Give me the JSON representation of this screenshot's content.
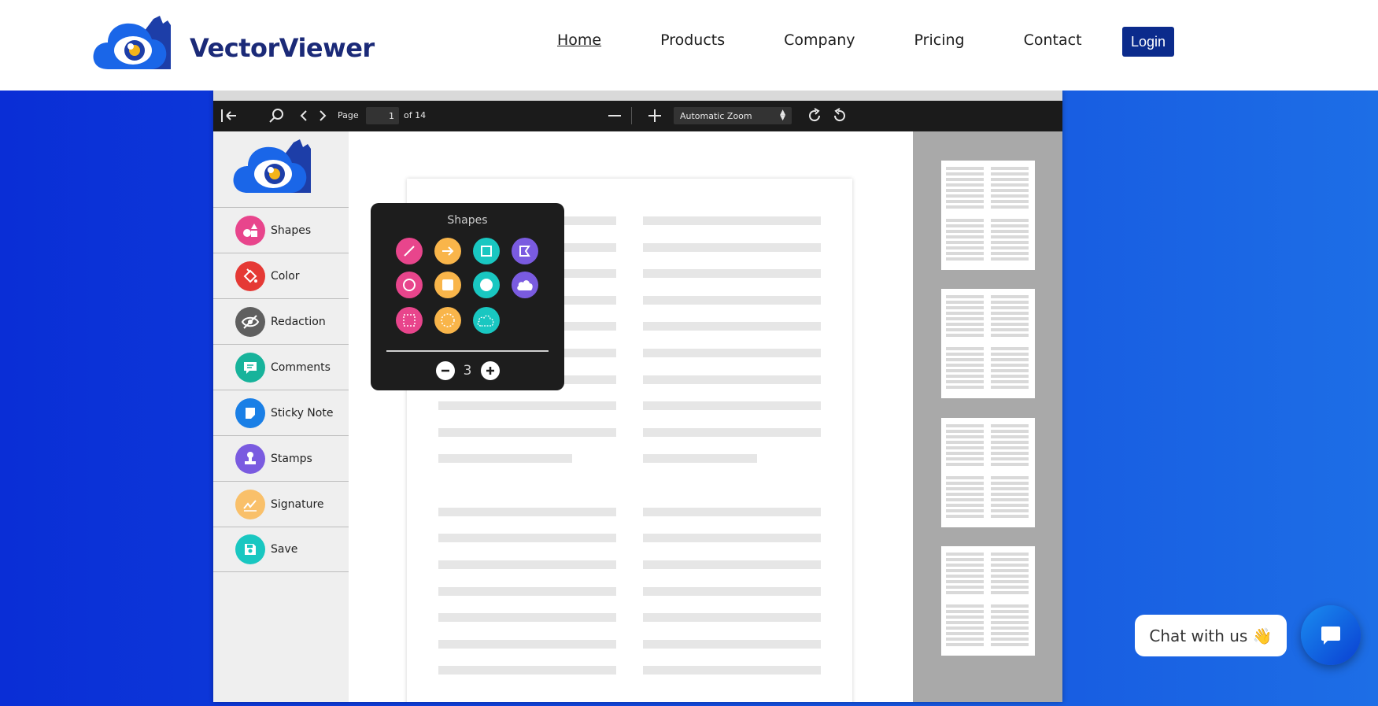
{
  "nav": {
    "brand": "VectorViewer",
    "links": [
      "Home",
      "Products",
      "Company",
      "Pricing",
      "Contact"
    ],
    "login": "Login"
  },
  "viewer": {
    "toolbar": {
      "page_label": "Page",
      "page_value": "1",
      "page_total": "of 14",
      "zoom": "Automatic Zoom"
    },
    "sidebar": {
      "items": [
        {
          "label": "Shapes",
          "icon": "shapes-icon",
          "color": "#e8458c"
        },
        {
          "label": "Color",
          "icon": "paint-bucket-icon",
          "color": "#e53935"
        },
        {
          "label": "Redaction",
          "icon": "eye-slash-icon",
          "color": "#5f5f5f"
        },
        {
          "label": "Comments",
          "icon": "comment-icon",
          "color": "#17b39b"
        },
        {
          "label": "Sticky Note",
          "icon": "sticky-note-icon",
          "color": "#1a7fe6"
        },
        {
          "label": "Stamps",
          "icon": "stamp-icon",
          "color": "#7a5be0"
        },
        {
          "label": "Signature",
          "icon": "signature-icon",
          "color": "#f9c06a"
        },
        {
          "label": "Save",
          "icon": "save-icon",
          "color": "#19c7c1"
        }
      ]
    },
    "shapes_popup": {
      "title": "Shapes",
      "stroke_width": "3",
      "shapes": [
        {
          "icon": "line-icon",
          "color": "#e8458c"
        },
        {
          "icon": "arrow-icon",
          "color": "#f9b54a"
        },
        {
          "icon": "rectangle-icon",
          "color": "#19c7c1"
        },
        {
          "icon": "polygon-icon",
          "color": "#7a5be0"
        },
        {
          "icon": "circle-outline-icon",
          "color": "#e8458c"
        },
        {
          "icon": "filled-square-icon",
          "color": "#f9b54a"
        },
        {
          "icon": "filled-circle-icon",
          "color": "#19c7c1"
        },
        {
          "icon": "cloud-icon",
          "color": "#7a5be0"
        },
        {
          "icon": "dashed-square-icon",
          "color": "#e8458c"
        },
        {
          "icon": "dashed-circle-icon",
          "color": "#f9b54a"
        },
        {
          "icon": "dashed-cloud-icon",
          "color": "#19c7c1"
        }
      ]
    }
  },
  "chat": {
    "label": "Chat with us",
    "emoji": "👋"
  }
}
